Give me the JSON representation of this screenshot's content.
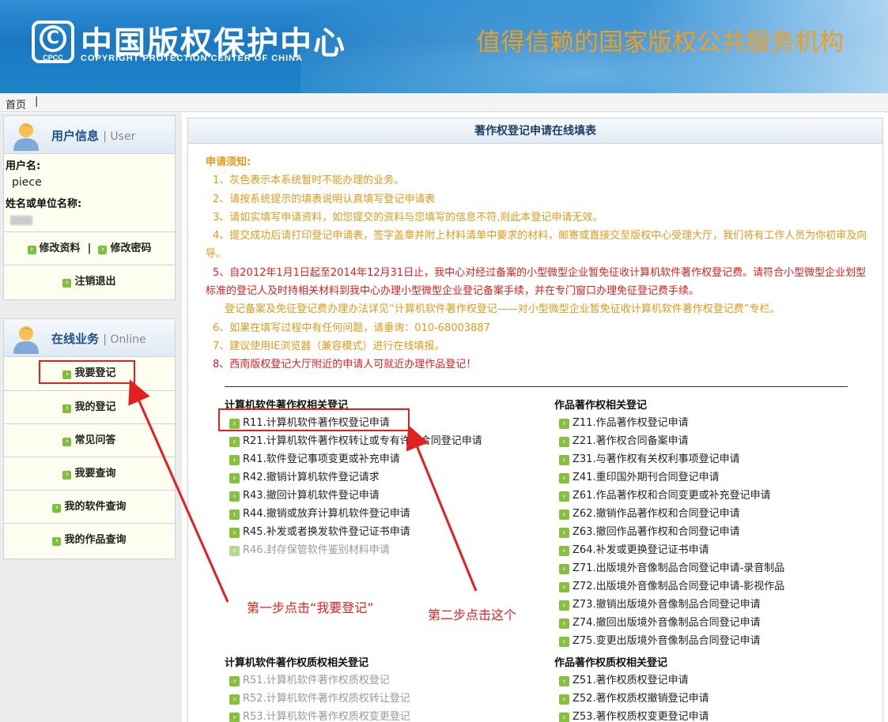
{
  "header": {
    "logo_mark": "C",
    "logo_small": "CPCC",
    "logo_cn": "中国版权保护中心",
    "logo_en": "COPYRIGHT PROTECTION CENTER OF CHINA",
    "slogan": "值得信赖的国家版权公共服务机构"
  },
  "nav": {
    "home": "首页",
    "sep": "|"
  },
  "user_panel": {
    "title": "用户信息",
    "title_en": "User",
    "username_label": "用户名:",
    "username": "piece",
    "name_label": "姓名或单位名称:",
    "edit_profile": "修改资料",
    "divider": "|",
    "change_password": "修改密码",
    "logout": "注销退出"
  },
  "online_panel": {
    "title": "在线业务",
    "title_en": "Online",
    "items": [
      "我要登记",
      "我的登记",
      "常见问答",
      "我要查询",
      "我的软件查询",
      "我的作品查询"
    ]
  },
  "main": {
    "title": "著作权登记申请在线填表",
    "notice_title": "申请须知:",
    "notices": [
      "1、灰色表示本系统暂时不能办理的业务。",
      "2、请按系统提示的填表说明认真填写登记申请表",
      "3、请如实填写申请资料，如您提交的资料与您填写的信息不符,则此本登记申请无效。",
      "4、提交成功后请打印登记申请表，签字盖章并附上材料清单中要求的材料，邮寄或直接交至版权中心受理大厅，我们将有工作人员为你初审及向导。",
      "5、自2012年1月1日起至2014年12月31日止，我中心对经过备案的小型微型企业暂免征收计算机软件著作权登记费。请符合小型微型企业划型标准的登记人及时持相关材料到我中心办理小型微型企业登记备案手续，并在专门窗口办理免征登记费手续。",
      "登记备案及免征登记费办理办法详见“计算机软件著作权登记——对小型微型企业暂免征收计算机软件著作权登记费”专栏。",
      "6、如果在填写过程中有任何问题，请垂询：010-68003887",
      "7、建议使用IE浏览器（兼容模式）进行在线填报。",
      "8、西南版权登记大厅附近的申请人可就近办理作品登记！"
    ],
    "software_title": "计算机软件著作权相关登记",
    "software_items": [
      "R11.计算机软件著作权登记申请",
      "R21.计算机软件著作权转让或专有许可合同登记申请",
      "R41.软件登记事项变更或补充申请",
      "R42.撤销计算机软件登记请求",
      "R43.撤回计算机软件登记申请",
      "R44.撤销或放弃计算机软件登记申请",
      "R45.补发或者换发软件登记证书申请",
      "R46.封存保管软件鉴别材料申请"
    ],
    "works_title": "作品著作权相关登记",
    "works_items": [
      "Z11.作品著作权登记申请",
      "Z21.著作权合同备案申请",
      "Z31.与著作权有关权利事项登记申请",
      "Z41.重印国外期刊合同登记申请",
      "Z61.作品著作权和合同变更或补充登记申请",
      "Z62.撤销作品著作权和合同登记申请",
      "Z63.撤回作品著作权和合同登记申请",
      "Z64.补发或更换登记证书申请",
      "Z71.出版境外音像制品合同登记申请-录音制品",
      "Z72.出版境外音像制品合同登记申请-影视作品",
      "Z73.撤销出版境外音像制品合同登记申请",
      "Z74.撤回出版境外音像制品合同登记申请",
      "Z75.变更出版境外音像制品合同登记申请"
    ],
    "software_pledge_title": "计算机软件著作权质权相关登记",
    "software_pledge_items": [
      "R51.计算机软件著作权质权登记",
      "R52.计算机软件著作权质权转让登记",
      "R53.计算机软件著作权质权变更登记"
    ],
    "works_pledge_title": "作品著作权质权相关登记",
    "works_pledge_items": [
      "Z51.著作权质权登记申请",
      "Z52.著作权质权撤销登记申请",
      "Z53.著作权质权变更登记申请"
    ]
  },
  "annotations": {
    "step1": "第一步点击“我要登记”",
    "step2": "第二步点击这个"
  },
  "colors": {
    "orange": "#e29a1a",
    "red": "#e02020",
    "brand_blue": "#1a78c2"
  }
}
